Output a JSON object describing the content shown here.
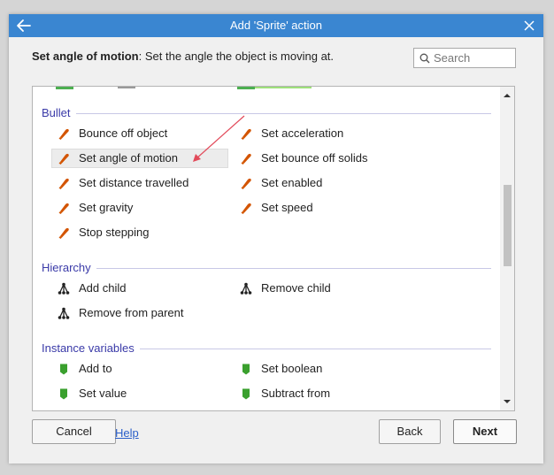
{
  "dialog": {
    "title": "Add 'Sprite' action",
    "description_name": "Set angle of motion",
    "description_text": ": Set the angle the object is moving at."
  },
  "search": {
    "placeholder": "Search",
    "value": ""
  },
  "sections": [
    {
      "name": "Bullet",
      "icon": "bullet-icon",
      "items": [
        {
          "label": "Bounce off object"
        },
        {
          "label": "Set acceleration"
        },
        {
          "label": "Set angle of motion",
          "selected": true
        },
        {
          "label": "Set bounce off solids"
        },
        {
          "label": "Set distance travelled"
        },
        {
          "label": "Set enabled"
        },
        {
          "label": "Set gravity"
        },
        {
          "label": "Set speed"
        },
        {
          "label": "Stop stepping"
        }
      ]
    },
    {
      "name": "Hierarchy",
      "icon": "hierarchy-icon",
      "items": [
        {
          "label": "Add child"
        },
        {
          "label": "Remove child"
        },
        {
          "label": "Remove from parent"
        }
      ]
    },
    {
      "name": "Instance variables",
      "icon": "instance-variable-icon",
      "items": [
        {
          "label": "Add to"
        },
        {
          "label": "Set boolean"
        },
        {
          "label": "Set value"
        },
        {
          "label": "Subtract from"
        }
      ]
    }
  ],
  "buttons": {
    "cancel": "Cancel",
    "help": "Help",
    "back": "Back",
    "next": "Next"
  },
  "colors": {
    "titlebar": "#3a86d1",
    "section_text": "#3a3aa8",
    "bullet_icon": "#d35400",
    "instance_var_icon": "#3aa02e",
    "annotation_arrow": "#e24a5a"
  }
}
